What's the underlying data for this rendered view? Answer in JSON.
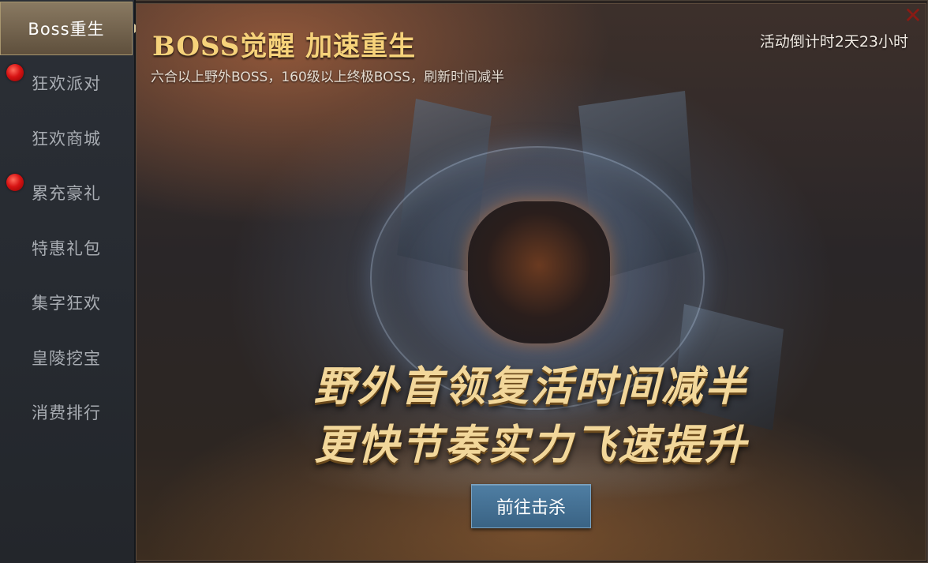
{
  "sidebar": {
    "items": [
      {
        "label": "Boss重生",
        "active": true,
        "badge": false
      },
      {
        "label": "狂欢派对",
        "active": false,
        "badge": true
      },
      {
        "label": "狂欢商城",
        "active": false,
        "badge": false
      },
      {
        "label": "累充豪礼",
        "active": false,
        "badge": true
      },
      {
        "label": "特惠礼包",
        "active": false,
        "badge": false
      },
      {
        "label": "集字狂欢",
        "active": false,
        "badge": false
      },
      {
        "label": "皇陵挖宝",
        "active": false,
        "badge": false
      },
      {
        "label": "消费排行",
        "active": false,
        "badge": false
      }
    ]
  },
  "banner": {
    "title": "BOSS觉醒 加速重生",
    "subtitle": "六合以上野外BOSS，160级以上终极BOSS，刷新时间减半",
    "countdown": "活动倒计时2天23小时",
    "slogan_line1": "野外首领复活时间减半",
    "slogan_line2": "更快节奏实力飞速提升",
    "action_button": "前往击杀"
  },
  "icons": {
    "close": "close-icon",
    "badge": "red-dot-badge"
  },
  "colors": {
    "active_tab": "#7a6a52",
    "title_gold": "#f6d27a",
    "button_blue": "#4a7799",
    "badge_red": "#d81414",
    "close_red": "#8b1a14"
  }
}
